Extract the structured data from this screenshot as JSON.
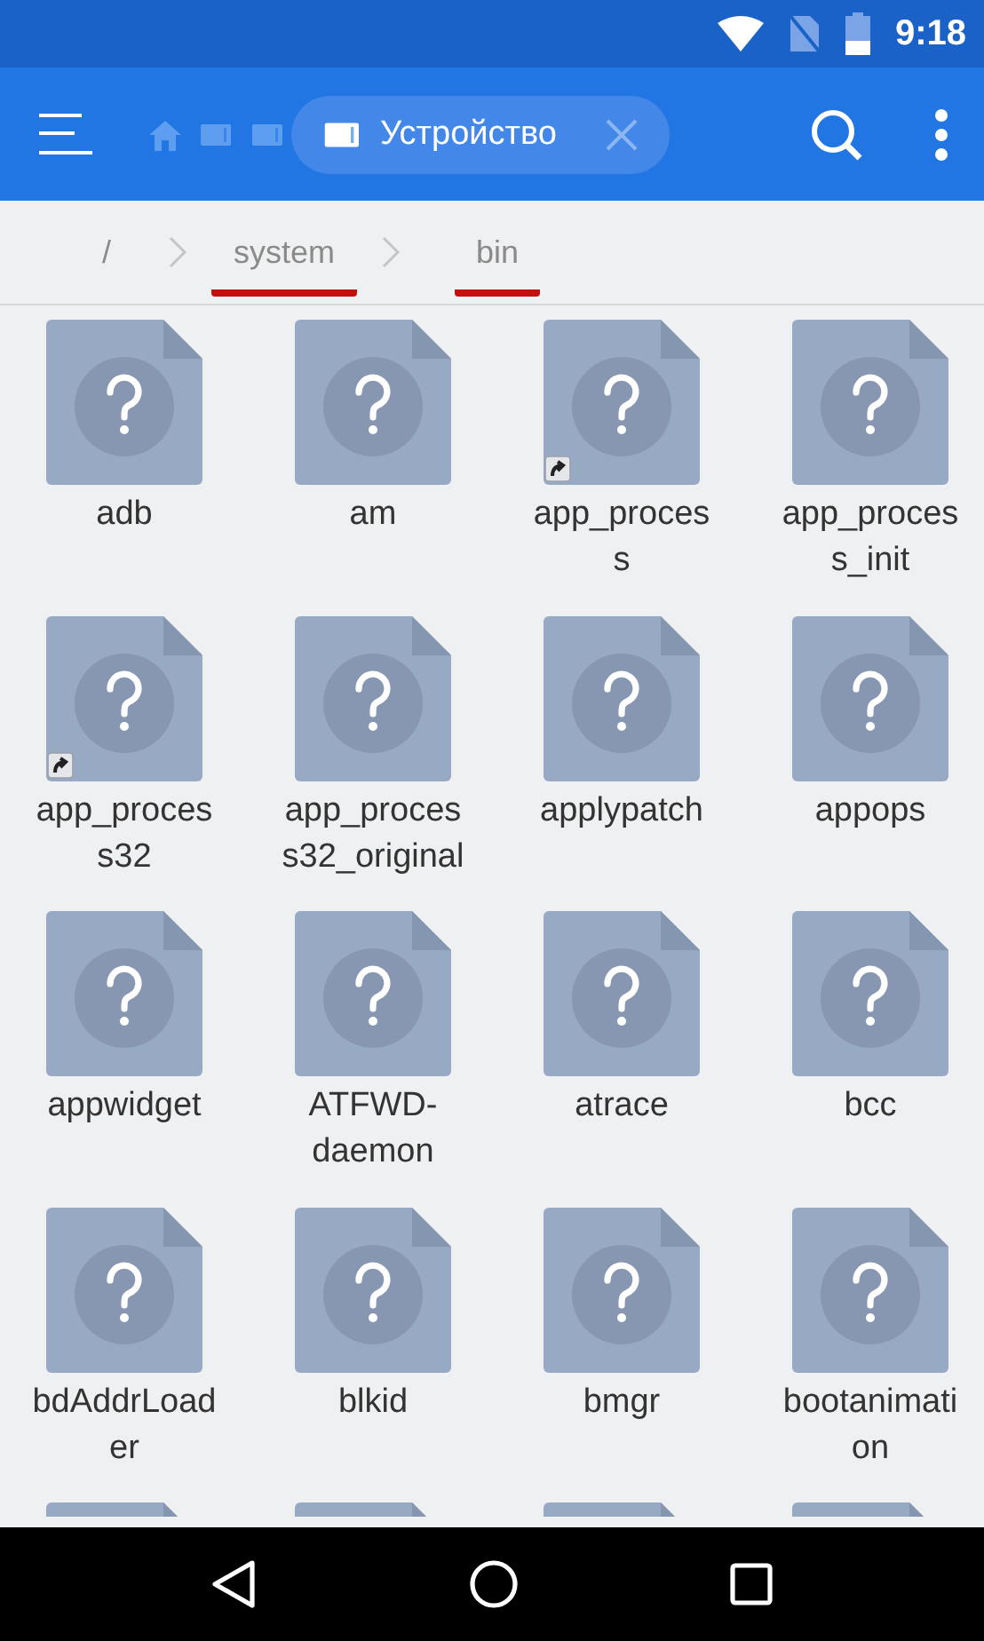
{
  "status_bar": {
    "time": "9:18"
  },
  "toolbar": {
    "location": "Устройство"
  },
  "path": [
    {
      "label": "/",
      "underlined": false
    },
    {
      "label": "system",
      "underlined": true
    },
    {
      "label": "bin",
      "underlined": true
    }
  ],
  "files": [
    {
      "name": "adb",
      "shortcut": false
    },
    {
      "name": "am",
      "shortcut": false
    },
    {
      "name": "app_process",
      "shortcut": true
    },
    {
      "name": "app_process_init",
      "shortcut": false
    },
    {
      "name": "app_process32",
      "shortcut": true
    },
    {
      "name": "app_process32_original",
      "shortcut": false
    },
    {
      "name": "applypatch",
      "shortcut": false
    },
    {
      "name": "appops",
      "shortcut": false
    },
    {
      "name": "appwidget",
      "shortcut": false
    },
    {
      "name": "ATFWD-daemon",
      "shortcut": false
    },
    {
      "name": "atrace",
      "shortcut": false
    },
    {
      "name": "bcc",
      "shortcut": false
    },
    {
      "name": "bdAddrLoader",
      "shortcut": false
    },
    {
      "name": "blkid",
      "shortcut": false
    },
    {
      "name": "bmgr",
      "shortcut": false
    },
    {
      "name": "bootanimation",
      "shortcut": false
    },
    {
      "kind": "cut"
    },
    {
      "kind": "cut"
    },
    {
      "kind": "cut"
    },
    {
      "kind": "cut"
    }
  ]
}
